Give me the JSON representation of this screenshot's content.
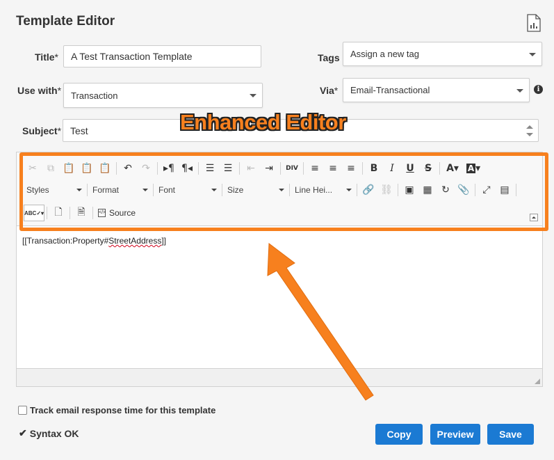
{
  "header": {
    "title": "Template Editor"
  },
  "form": {
    "title_label": "Title",
    "title_value": "A Test Transaction Template",
    "tags_label": "Tags",
    "tags_placeholder": "Assign a new tag",
    "use_with_label": "Use with",
    "use_with_value": "Transaction",
    "via_label": "Via",
    "via_value": "Email-Transactional",
    "subject_label": "Subject",
    "subject_value": "Test",
    "required_mark": "*"
  },
  "annotation": {
    "banner_text": "Enhanced Editor",
    "accent_color": "#f7801e"
  },
  "toolbar": {
    "styles_label": "Styles",
    "format_label": "Format",
    "font_label": "Font",
    "size_label": "Size",
    "line_height_label": "Line Hei...",
    "source_label": "Source",
    "spell_label": "ABC"
  },
  "editor": {
    "content_prefix": "[[Transaction:Property#",
    "content_misspelled": "StreetAddress",
    "content_suffix": "]]"
  },
  "footer": {
    "track_label": "Track email response time for this template",
    "syntax_status": "Syntax OK",
    "copy_label": "Copy",
    "preview_label": "Preview",
    "save_label": "Save",
    "button_color": "#1b7ad3"
  }
}
